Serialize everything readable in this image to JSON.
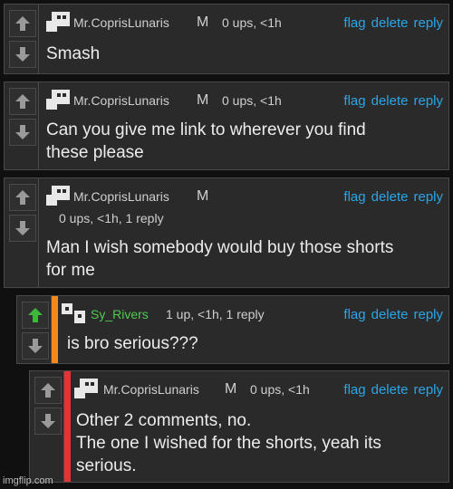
{
  "comments": [
    {
      "user": "Mr.CoprisLunaris",
      "mod": "M",
      "meta": "0 ups, <1h",
      "text": [
        "Smash"
      ]
    },
    {
      "user": "Mr.CoprisLunaris",
      "mod": "M",
      "meta": "0 ups, <1h",
      "text": [
        "Can you give me link to wherever you find",
        "these please"
      ]
    },
    {
      "user": "Mr.CoprisLunaris",
      "mod": "M",
      "meta": "0 ups, <1h, 1 reply",
      "text": [
        "Man I wish somebody would buy those shorts",
        "for me"
      ]
    },
    {
      "user": "Sy_Rivers",
      "mod": "",
      "meta": "1 up, <1h, 1 reply",
      "text": [
        "is bro serious???"
      ]
    },
    {
      "user": "Mr.CoprisLunaris",
      "mod": "M",
      "meta": "0 ups, <1h",
      "text": [
        "Other 2 comments, no.",
        "The one I wished for the shorts, yeah its",
        "serious."
      ]
    }
  ],
  "actions": {
    "flag": "flag",
    "delete": "delete",
    "reply": "reply"
  },
  "watermark": "imgflip.com",
  "colors": {
    "accent_link": "#2aa6e8",
    "upvoted": "#3db83a",
    "reply_stripe_1": "#f08a1c",
    "reply_stripe_2": "#e53333"
  },
  "icons": {
    "upvote": "arrow-up-icon",
    "downvote": "arrow-down-icon",
    "avatar": "pixel-avatar-icon"
  }
}
